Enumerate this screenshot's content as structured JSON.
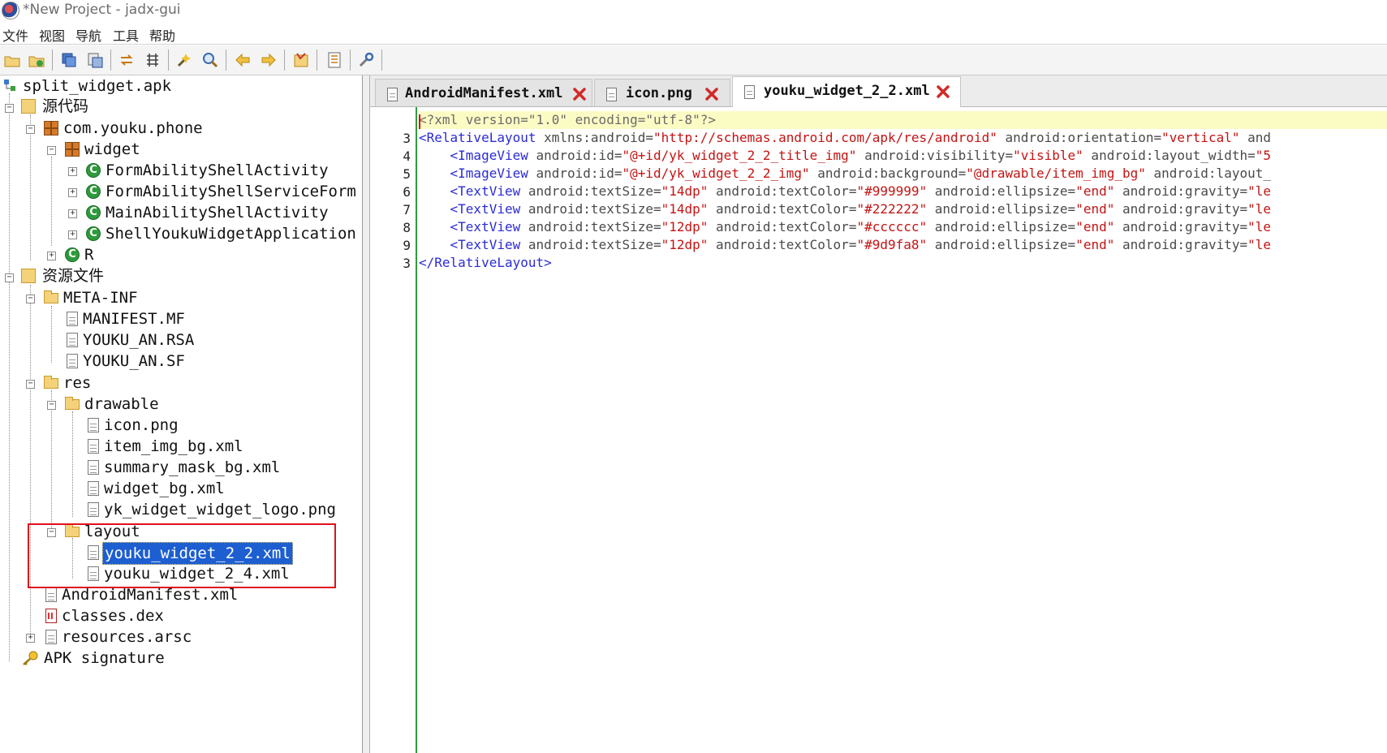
{
  "window": {
    "title": "*New Project - jadx-gui"
  },
  "menu": {
    "items": [
      "文件",
      "视图",
      "导航",
      "工具",
      "帮助"
    ]
  },
  "toolbar": {
    "buttons": [
      "open-file-icon",
      "add-files-icon",
      "save-all-icon",
      "export-icon",
      "sync-icon",
      "flatten-packages-icon",
      "deobfuscation-icon",
      "search-icon",
      "back-icon",
      "forward-icon",
      "log-viewer-icon",
      "preferences-icon",
      "settings-icon"
    ]
  },
  "tree": {
    "root": "split_widget.apk",
    "source": "源代码",
    "package": "com.youku.phone",
    "subpackage": "widget",
    "classes": [
      "FormAbilityShellActivity",
      "FormAbilityShellServiceForm",
      "MainAbilityShellActivity",
      "ShellYoukuWidgetApplication"
    ],
    "r_class": "R",
    "resources": "资源文件",
    "meta_inf": "META-INF",
    "meta_files": [
      "MANIFEST.MF",
      "YOUKU_AN.RSA",
      "YOUKU_AN.SF"
    ],
    "res": "res",
    "drawable": "drawable",
    "drawable_files": [
      "icon.png",
      "item_img_bg.xml",
      "summary_mask_bg.xml",
      "widget_bg.xml",
      "yk_widget_widget_logo.png"
    ],
    "layout": "layout",
    "layout_files": [
      "youku_widget_2_2.xml",
      "youku_widget_2_4.xml"
    ],
    "manifest": "AndroidManifest.xml",
    "dex": "classes.dex",
    "arsc": "resources.arsc",
    "signature": "APK signature"
  },
  "tabs": [
    {
      "label": "AndroidManifest.xml",
      "active": false
    },
    {
      "label": "icon.png",
      "active": false
    },
    {
      "label": "youku_widget_2_2.xml",
      "active": true
    }
  ],
  "editor": {
    "line_numbers": [
      "",
      "3",
      "4",
      "5",
      "6",
      "7",
      "8",
      "9",
      "3"
    ],
    "lines": {
      "l0": {
        "decl": "<?xml version=\"1.0\" encoding=\"utf-8\"?>"
      },
      "l1": {
        "tag": "<RelativeLayout",
        "a1": " xmlns:android=",
        "v1": "\"http://schemas.android.com/apk/res/android\"",
        "a2": " android:orientation=",
        "v2": "\"vertical\"",
        "a3": " and"
      },
      "l2": {
        "indent": "    ",
        "tag": "<ImageView",
        "a1": " android:id=",
        "v1": "\"@+id/yk_widget_2_2_title_img\"",
        "a2": " android:visibility=",
        "v2": "\"visible\"",
        "a3": " android:layout_width=",
        "v3": "\"5"
      },
      "l3": {
        "indent": "    ",
        "tag": "<ImageView",
        "a1": " android:id=",
        "v1": "\"@+id/yk_widget_2_2_img\"",
        "a2": " android:background=",
        "v2": "\"@drawable/item_img_bg\"",
        "a3": " android:layout_"
      },
      "l4": {
        "indent": "    ",
        "tag": "<TextView",
        "a1": " android:textSize=",
        "v1": "\"14dp\"",
        "a2": " android:textColor=",
        "v2": "\"#999999\"",
        "a3": " android:ellipsize=",
        "v3": "\"end\"",
        "a4": " android:gravity=",
        "v4": "\"le"
      },
      "l5": {
        "indent": "    ",
        "tag": "<TextView",
        "a1": " android:textSize=",
        "v1": "\"14dp\"",
        "a2": " android:textColor=",
        "v2": "\"#222222\"",
        "a3": " android:ellipsize=",
        "v3": "\"end\"",
        "a4": " android:gravity=",
        "v4": "\"le"
      },
      "l6": {
        "indent": "    ",
        "tag": "<TextView",
        "a1": " android:textSize=",
        "v1": "\"12dp\"",
        "a2": " android:textColor=",
        "v2": "\"#cccccc\"",
        "a3": " android:ellipsize=",
        "v3": "\"end\"",
        "a4": " android:gravity=",
        "v4": "\"le"
      },
      "l7": {
        "indent": "    ",
        "tag": "<TextView",
        "a1": " android:textSize=",
        "v1": "\"12dp\"",
        "a2": " android:textColor=",
        "v2": "\"#9d9fa8\"",
        "a3": " android:ellipsize=",
        "v3": "\"end\"",
        "a4": " android:gravity=",
        "v4": "\"le"
      },
      "l8": {
        "tag": "</RelativeLayout>"
      }
    }
  },
  "colors": {
    "selection": "#1d5ed1",
    "highlight_box": "#e0101a",
    "current_line": "#fbfbc4",
    "xml_tag": "#2b2bd6",
    "xml_value": "#c31414"
  }
}
